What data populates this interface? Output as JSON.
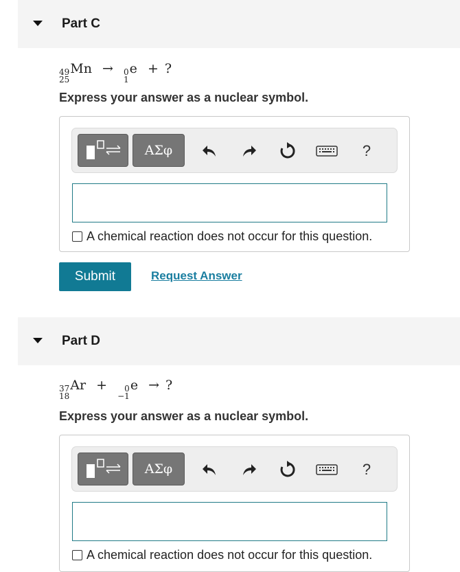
{
  "part_c": {
    "title": "Part C",
    "equation": {
      "reactant": {
        "mass": "49",
        "atomic": "25",
        "symbol": "Mn"
      },
      "arrow": "→",
      "product": {
        "mass": "0",
        "atomic": "1",
        "symbol": "e"
      },
      "plus": "+",
      "unknown": "?"
    },
    "instruction": "Express your answer as a nuclear symbol.",
    "input_value": "",
    "no_reaction_label": "A chemical reaction does not occur for this question.",
    "submit_label": "Submit",
    "request_label": "Request Answer"
  },
  "part_d": {
    "title": "Part D",
    "equation": {
      "reactant": {
        "mass": "37",
        "atomic": "18",
        "symbol": "Ar"
      },
      "plus": "+",
      "electron": {
        "mass": "0",
        "atomic": "−1",
        "symbol": "e"
      },
      "arrow": "→",
      "unknown": "?"
    },
    "instruction": "Express your answer as a nuclear symbol.",
    "input_value": "",
    "no_reaction_label": "A chemical reaction does not occur for this question."
  },
  "toolbar": {
    "greek_label": "ΑΣφ",
    "help_label": "?",
    "icons": [
      "templates-icon",
      "undo-icon",
      "redo-icon",
      "reset-icon",
      "keyboard-icon",
      "help-icon"
    ]
  },
  "colors": {
    "header_bg": "#f4f4f4",
    "submit_bg": "#117a94",
    "link": "#1a7ea0",
    "tool_btn": "#767676",
    "input_border": "#1f7a86"
  }
}
